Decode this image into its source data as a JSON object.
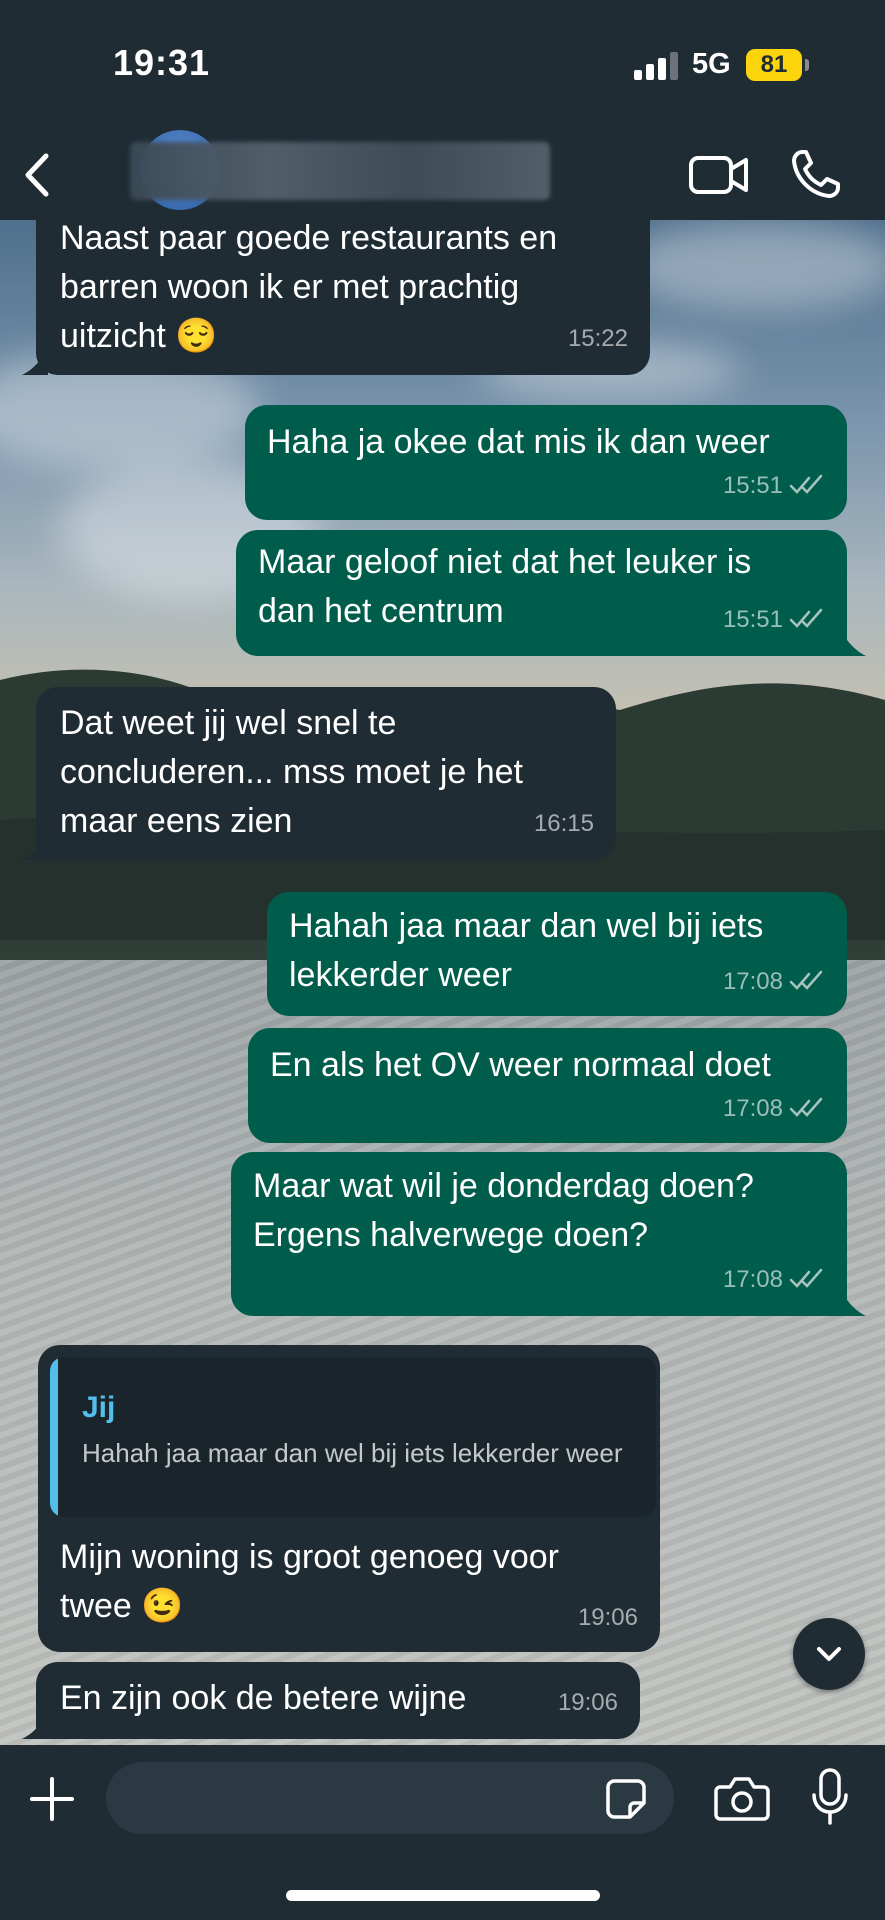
{
  "status": {
    "time": "19:31",
    "network": "5G",
    "battery": "81"
  },
  "header": {
    "contact_name": ""
  },
  "messages": [
    {
      "id": 0,
      "direction": "in",
      "text": "Naast paar goede restaurants en\nbarren woon ik er met prachtig\nuitzicht 😌",
      "time": "15:22"
    },
    {
      "id": 1,
      "direction": "out",
      "text": "Haha ja okee dat mis ik dan weer",
      "time": "15:51"
    },
    {
      "id": 2,
      "direction": "out",
      "text": "Maar geloof niet dat het leuker is\ndan het centrum",
      "time": "15:51"
    },
    {
      "id": 3,
      "direction": "in",
      "text": "Dat weet jij wel snel te\nconcluderen... mss moet je het\nmaar eens zien",
      "time": "16:15"
    },
    {
      "id": 4,
      "direction": "out",
      "text": "Hahah jaa maar dan wel bij iets\nlekkerder weer",
      "time": "17:08"
    },
    {
      "id": 5,
      "direction": "out",
      "text": "En als het OV weer normaal doet",
      "time": "17:08"
    },
    {
      "id": 6,
      "direction": "out",
      "text": "Maar wat wil je donderdag doen?\nErgens halverwege doen?",
      "time": "17:08"
    },
    {
      "id": 7,
      "direction": "in",
      "quote_author": "Jij",
      "quote_text": "Hahah jaa maar dan wel bij iets lekkerder weer",
      "text": "Mijn woning is groot genoeg voor\ntwee 😉",
      "time": "19:06"
    },
    {
      "id": 8,
      "direction": "in",
      "text": "En zijn ook de betere wijne",
      "time": "19:06"
    }
  ],
  "composer": {
    "placeholder": ""
  },
  "icons": {
    "back": "chevron-left-icon",
    "video": "video-camera-icon",
    "call": "phone-icon",
    "plus": "plus-icon",
    "sticker": "sticker-icon",
    "camera": "camera-icon",
    "mic": "microphone-icon",
    "scroll": "chevron-down-icon",
    "read": "double-check-icon"
  },
  "colors": {
    "incoming": "#202c33",
    "outgoing": "#005c4b",
    "read_ticks": "#a8c3bd",
    "quote_accent": "#53bdeb",
    "battery": "#fbd40b"
  }
}
